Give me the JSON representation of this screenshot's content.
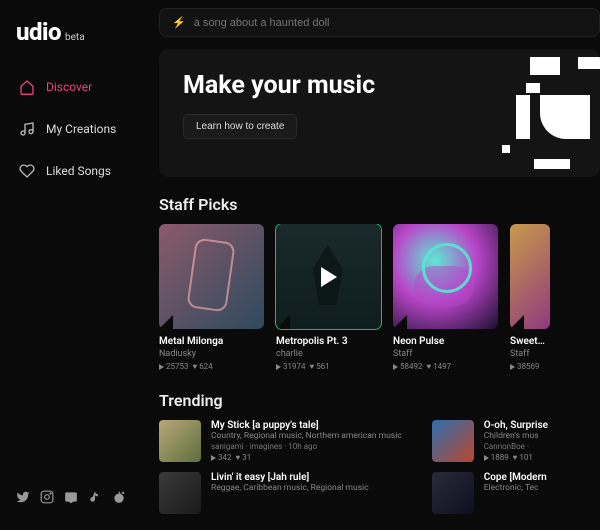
{
  "logo": {
    "main": "udio",
    "tag": "beta"
  },
  "nav": {
    "items": [
      {
        "label": "Discover",
        "icon": "home-icon"
      },
      {
        "label": "My Creations",
        "icon": "music-note-icon"
      },
      {
        "label": "Liked Songs",
        "icon": "heart-icon"
      }
    ]
  },
  "search": {
    "placeholder": "a song about a haunted doll"
  },
  "hero": {
    "title": "Make your music",
    "cta": "Learn how to create"
  },
  "sections": {
    "staff_picks": {
      "title": "Staff Picks",
      "tracks": [
        {
          "title": "Metal Milonga",
          "artist": "Nadiusky",
          "plays": "25753",
          "likes": "624"
        },
        {
          "title": "Metropolis Pt. 3",
          "artist": "charlie",
          "plays": "31974",
          "likes": "561"
        },
        {
          "title": "Neon Pulse",
          "artist": "Staff",
          "plays": "58492",
          "likes": "1497"
        },
        {
          "title": "Sweetest Cra",
          "artist": "Staff",
          "plays": "38569",
          "likes": ""
        }
      ]
    },
    "trending": {
      "title": "Trending",
      "left": [
        {
          "title": "My Stick [a puppy's tale]",
          "genre": "Country, Regional music, Northern american music",
          "meta": "sanigami · imagines · 10h ago",
          "plays": "342",
          "likes": "31"
        },
        {
          "title": "Livin' it easy [Jah rule]",
          "genre": "Reggae, Caribbean music, Regional music",
          "meta": "",
          "plays": "",
          "likes": ""
        }
      ],
      "right": [
        {
          "title": "O-oh, Surprise",
          "genre": "Children's mus",
          "meta": "CannonBoe ·",
          "plays": "1889",
          "likes": "101"
        },
        {
          "title": "Cope [Modern",
          "genre": "Electronic, Tec",
          "meta": "",
          "plays": "",
          "likes": ""
        }
      ]
    }
  }
}
